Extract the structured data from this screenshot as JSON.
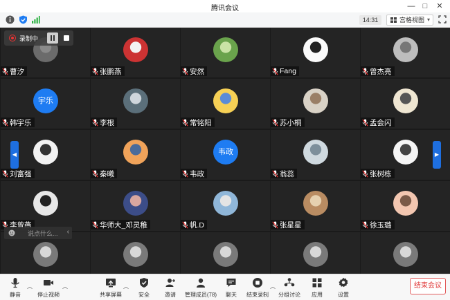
{
  "window": {
    "title": "腾讯会议"
  },
  "infobar": {
    "time": "14:31",
    "view_label": "宫格视图"
  },
  "recording": {
    "label": "录制中"
  },
  "participants": [
    {
      "name": "曹汐"
    },
    {
      "name": "张鹏燕"
    },
    {
      "name": "安然"
    },
    {
      "name": "Fang"
    },
    {
      "name": "曾杰亮"
    },
    {
      "name": "韩宇乐",
      "avatar_text": "宇乐"
    },
    {
      "name": "李根"
    },
    {
      "name": "常铭阳"
    },
    {
      "name": "苏小桐"
    },
    {
      "name": "孟会闪"
    },
    {
      "name": "刘富强"
    },
    {
      "name": "秦曦"
    },
    {
      "name": "韦政",
      "avatar_text": "韦政"
    },
    {
      "name": "翁蕊"
    },
    {
      "name": "张树栋"
    },
    {
      "name": "李曾燕"
    },
    {
      "name": "华师大_邓灵稚"
    },
    {
      "name": "帆.D"
    },
    {
      "name": "张星星"
    },
    {
      "name": "徐玉璐"
    }
  ],
  "chat": {
    "placeholder": "说点什么..."
  },
  "toolbar": {
    "mute": "静音",
    "stop_video": "停止视频",
    "share": "共享屏幕",
    "security": "安全",
    "invite": "邀请",
    "manage": "管理成员(78)",
    "chat": "聊天",
    "end_record": "结束录制",
    "breakout": "分组讨论",
    "apps": "应用",
    "settings": "设置",
    "end_meeting": "结束会议"
  },
  "colors": {
    "accent": "#1e7cf2",
    "end": "#e03a3a",
    "bg": "#1a1a1a"
  }
}
